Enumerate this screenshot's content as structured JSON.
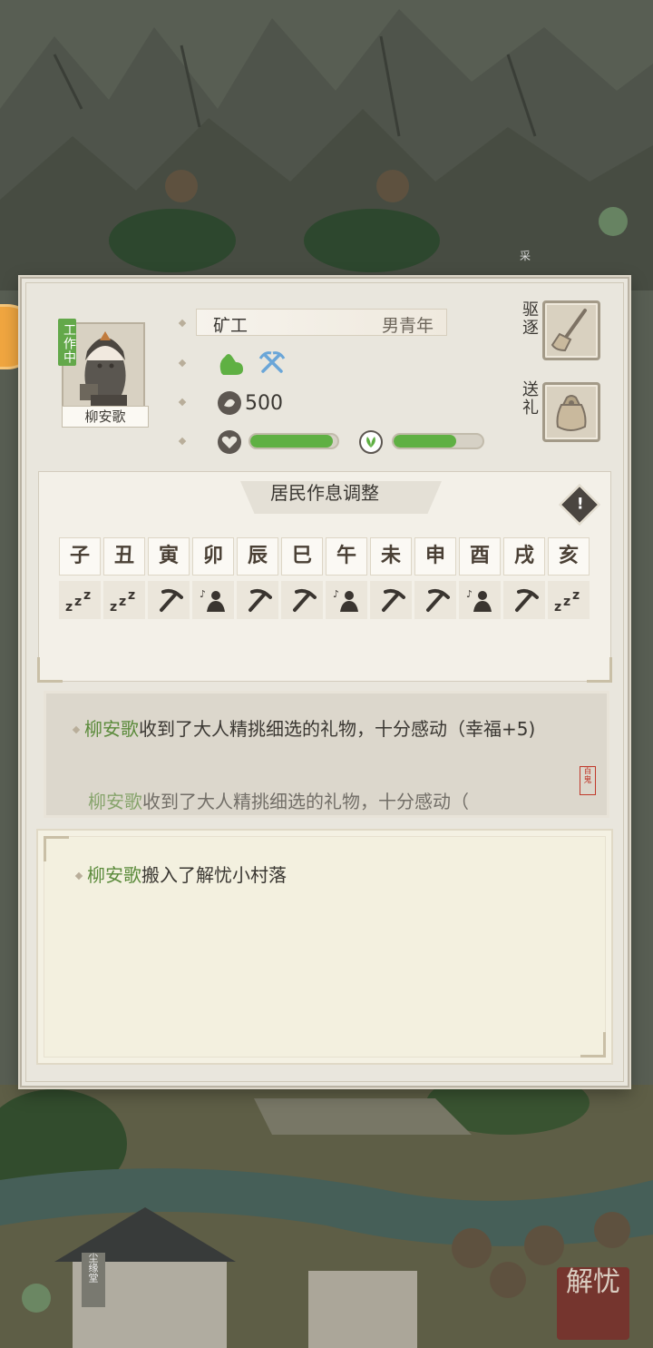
{
  "resident": {
    "status_badge": "工作中",
    "name": "柳安歌",
    "job": "矿工",
    "age_group": "男青年",
    "money": "500",
    "health_level": 0.95,
    "mood_level": 0.7
  },
  "actions": {
    "expel_label": "驱逐",
    "gift_label": "送礼"
  },
  "schedule": {
    "title": "居民作息调整",
    "hours": [
      "子",
      "丑",
      "寅",
      "卯",
      "辰",
      "巳",
      "午",
      "未",
      "申",
      "酉",
      "戌",
      "亥"
    ],
    "activities": [
      "sleep-icon",
      "sleep-icon",
      "pickaxe-icon",
      "leisure-icon",
      "pickaxe-icon",
      "pickaxe-icon",
      "leisure-icon",
      "pickaxe-icon",
      "pickaxe-icon",
      "leisure-icon",
      "pickaxe-icon",
      "sleep-icon"
    ]
  },
  "log_recent": {
    "entry1_name": "柳安歌",
    "entry1_text": "收到了大人精挑细选的礼物，十分感动（幸福+5)",
    "entry2_name": "柳安歌",
    "entry2_text": "收到了大人精挑细选的礼物，十分感动（",
    "seal": "百鬼"
  },
  "log_history": {
    "entry1_name": "柳安歌",
    "entry1_text": "搬入了解忧小村落"
  },
  "game": {
    "logo_text": "解忧",
    "building_sign": "尘缘堂",
    "side_sign": "采"
  },
  "colors": {
    "accent_green": "#5fb043",
    "name_green": "#5a8a3a",
    "panel": "#e9e6dd"
  }
}
